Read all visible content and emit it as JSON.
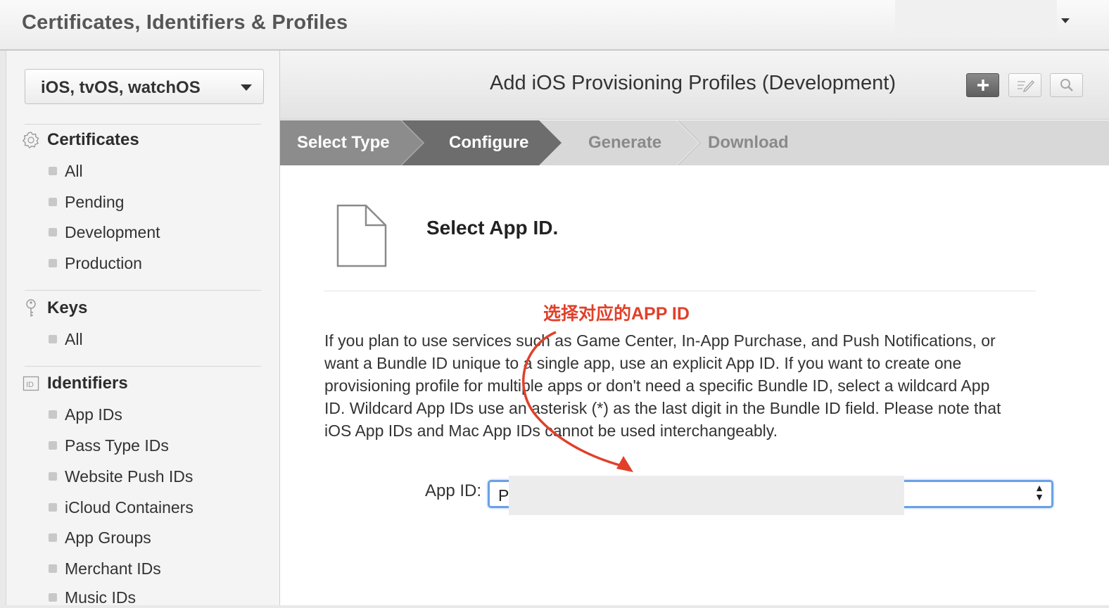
{
  "header": {
    "title": "Certificates, Identifiers & Profiles"
  },
  "sidebar": {
    "platform": "iOS, tvOS, watchOS",
    "sections": [
      {
        "title": "Certificates",
        "icon": "certificate-icon",
        "items": [
          "All",
          "Pending",
          "Development",
          "Production"
        ]
      },
      {
        "title": "Keys",
        "icon": "key-icon",
        "items": [
          "All"
        ]
      },
      {
        "title": "Identifiers",
        "icon": "id-icon",
        "items": [
          "App IDs",
          "Pass Type IDs",
          "Website Push IDs",
          "iCloud Containers",
          "App Groups",
          "Merchant IDs",
          "Music IDs"
        ]
      }
    ]
  },
  "main": {
    "title": "Add iOS Provisioning Profiles (Development)",
    "steps": [
      "Select Type",
      "Configure",
      "Generate",
      "Download"
    ],
    "active_step": 1,
    "section_title": "Select App ID.",
    "annotation": "选择对应的APP ID",
    "description": "If you plan to use services such as Game Center, In-App Purchase, and Push Notifications, or want a Bundle ID unique to a single app, use an explicit App ID. If you want to create one provisioning profile for multiple apps or don't need a specific Bundle ID, select a wildcard App ID. Wildcard App IDs use an asterisk (*) as the last digit in the Bundle ID field. Please note that iOS App IDs and Mac App IDs cannot be used interchangeably.",
    "app_id_label": "App ID:",
    "app_id_value": "P"
  },
  "colors": {
    "annotation": "#e0402a",
    "step_done": "#8c8c8c",
    "step_active": "#6b6b6b",
    "step_pending": "#d9d9d9",
    "focus": "#6aa0e6"
  }
}
